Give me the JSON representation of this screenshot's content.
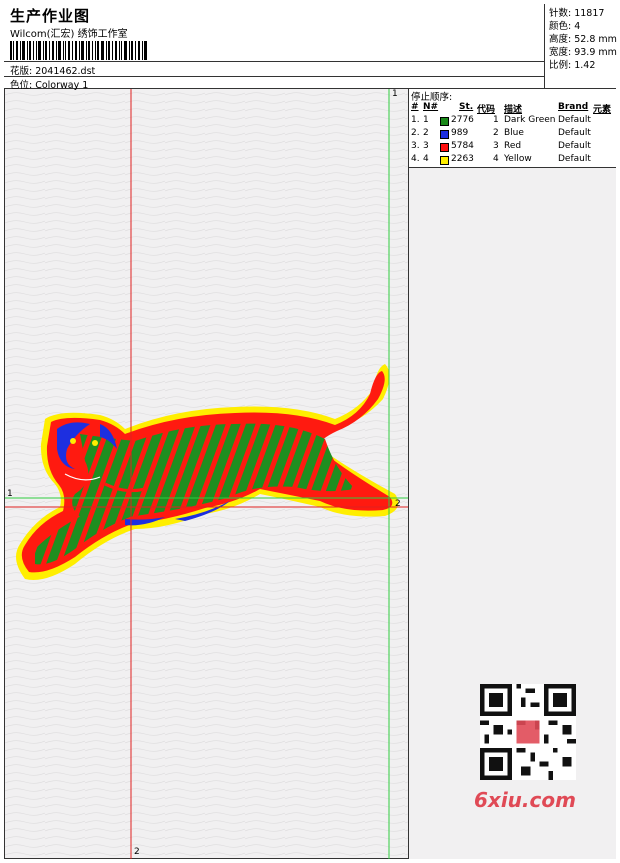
{
  "header": {
    "title": "生产作业图",
    "company": "Wilcom(汇宏) 绣饰工作室",
    "design_label": "花版: 2041462.dst",
    "colorway_label": "色位: Colorway 1"
  },
  "stats": [
    "针数: 11817",
    "颜色: 4",
    "高度: 52.8 mm",
    "宽度: 93.9 mm",
    "比例: 1.42"
  ],
  "stop_sequence": {
    "title": "停止顺序:",
    "columns": [
      "#",
      "N#",
      "St.",
      "代码",
      "描述",
      "Brand",
      "元素"
    ],
    "rows": [
      {
        "idx": "1.",
        "n": "1",
        "color": "#1a8a1a",
        "stitches": "2776",
        "code": "1",
        "desc": "Dark Green",
        "brand": "Default"
      },
      {
        "idx": "2.",
        "n": "2",
        "color": "#1d2fe0",
        "stitches": "989",
        "code": "2",
        "desc": "Blue",
        "brand": "Default"
      },
      {
        "idx": "3.",
        "n": "3",
        "color": "#ff1010",
        "stitches": "5784",
        "code": "3",
        "desc": "Red",
        "brand": "Default"
      },
      {
        "idx": "4.",
        "n": "4",
        "color": "#ffee00",
        "stitches": "2263",
        "code": "4",
        "desc": "Yellow",
        "brand": "Default"
      }
    ]
  },
  "guides": {
    "vertical_red_top": "",
    "vertical_red_bottom": "2",
    "vertical_green_top": "1",
    "horizontal_green_left": "1",
    "horizontal_red_right": "2"
  },
  "watermark": {
    "text": "6xiu.com"
  },
  "colors": {
    "guide_red": "#e02020",
    "guide_green": "#2ecc40",
    "background": "#f1f0f1"
  }
}
